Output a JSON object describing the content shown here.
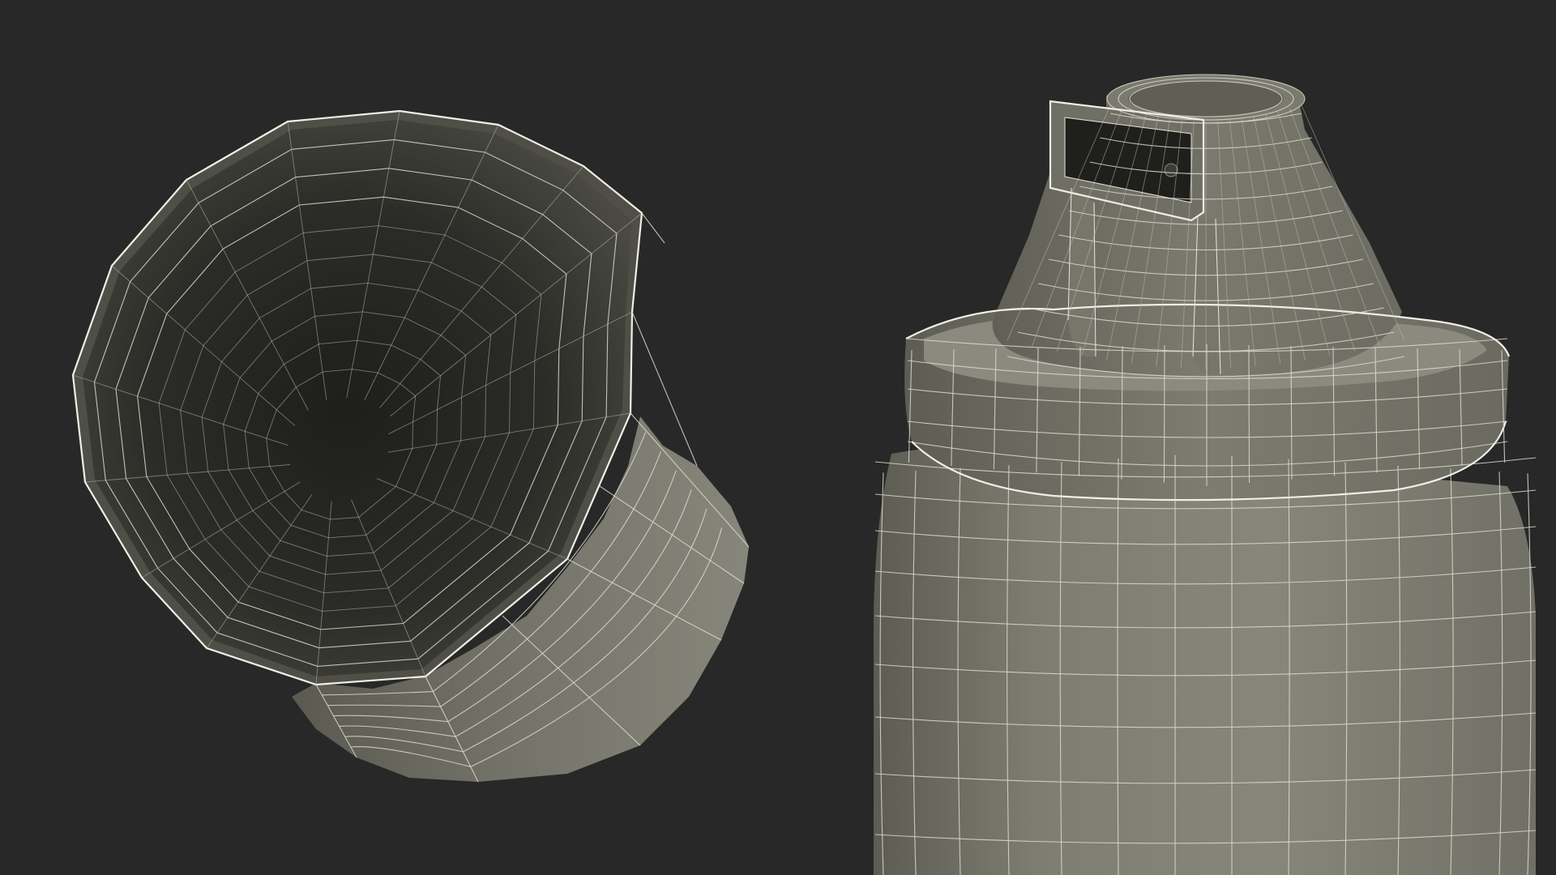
{
  "scene": {
    "description_none": "",
    "background_color": "#272827",
    "wire_color": "#e8e6dc",
    "body_color": "#7e7e72",
    "body_shadow_color": "#5f5f56",
    "interior_color": "#2c2c28"
  },
  "objects": [
    {
      "name": "spray-cap-wireframe"
    },
    {
      "name": "spray-can-wireframe"
    }
  ]
}
